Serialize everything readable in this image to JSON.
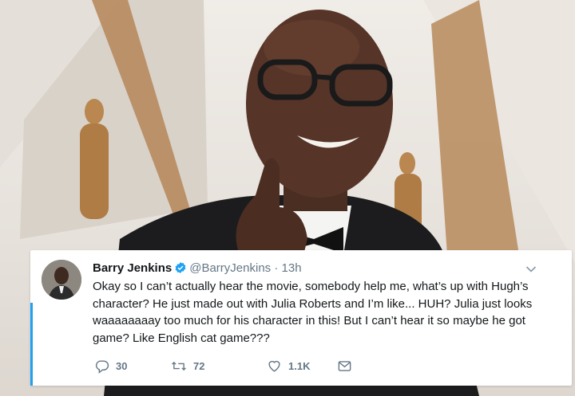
{
  "tweet": {
    "display_name": "Barry Jenkins",
    "handle": "@BarryJenkins",
    "separator": "·",
    "time": "13h",
    "text": "Okay so I can’t actually hear the movie, somebody help me, what’s up with Hugh’s character? He just made out with Julia Roberts and I’m like... HUH? Julia just looks waaaaaaaay too much for his character in this! But I can’t hear it so maybe he got game? Like English cat game???",
    "reply_count": "30",
    "retweet_count": "72",
    "like_count": "1.1K"
  },
  "icons": {
    "verified": "verified-badge-icon",
    "more": "chevron-down-icon",
    "reply": "reply-icon",
    "retweet": "retweet-icon",
    "like": "heart-icon",
    "dm": "envelope-icon"
  },
  "colors": {
    "accent": "#1da1f2",
    "secondary_text": "#657786",
    "primary_text": "#14171a"
  }
}
